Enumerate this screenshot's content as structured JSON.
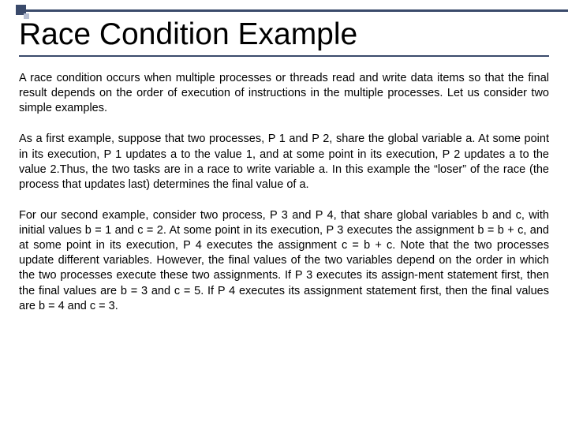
{
  "title": "Race Condition Example",
  "paragraphs": {
    "p1": "A race condition occurs when multiple processes or threads read and write data items so that the final result depends on the order of execution of instructions in the multiple processes. Let us consider two simple examples.",
    "p2": "As a first example, suppose that two processes, P 1 and P 2, share the global variable a. At some point in its execution, P 1 updates a to the value 1, and at some point in its execution, P 2 updates a to the value 2.Thus, the two tasks are in a race to write variable a. In this example the “loser” of the race (the process that updates last) determines the final value of a.",
    "p3": "For our second example, consider two process, P 3 and P 4, that share global variables b and c, with initial values b = 1 and c = 2. At some point in its execution, P 3 executes the assignment b = b + c, and at some point in its execution, P 4 executes the assignment c = b + c. Note that the two processes update different variables. However, the final values of the two variables depend on the order in which the two processes execute these two assignments. If P 3 executes its assign-ment statement first, then the final values are b = 3 and c = 5. If P 4 executes its assignment statement first, then the final values are b = 4 and c = 3."
  }
}
